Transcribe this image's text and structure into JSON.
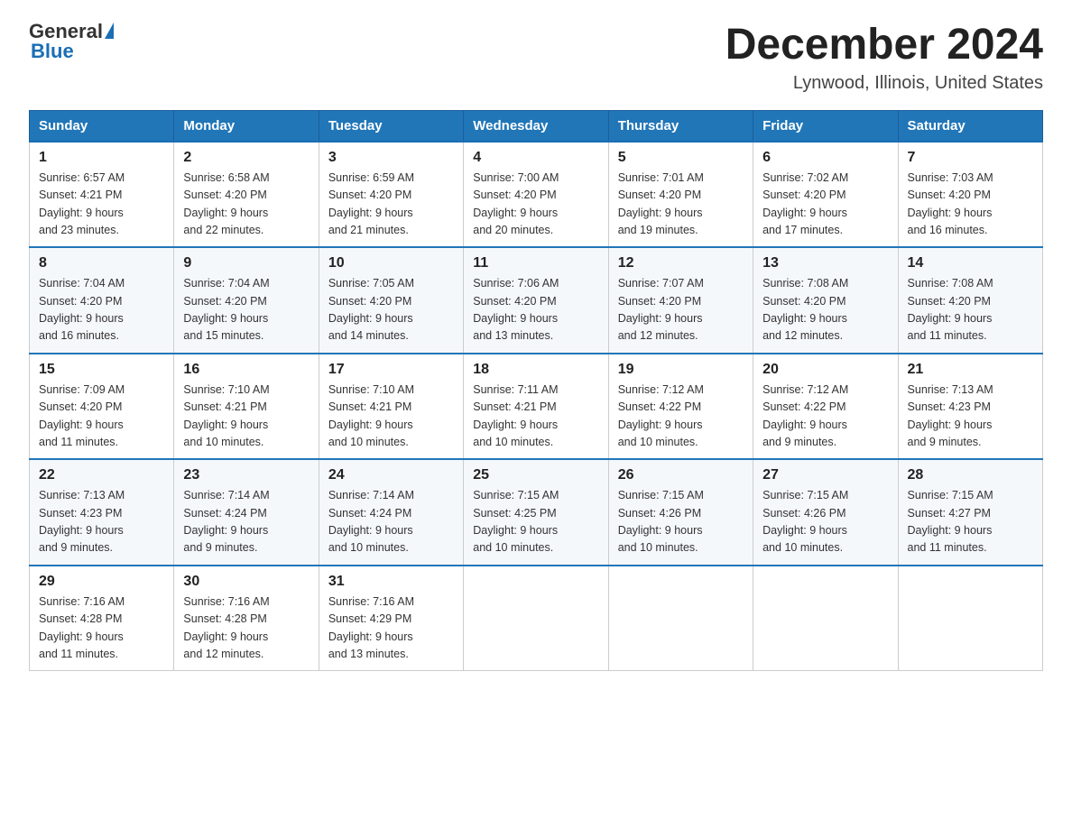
{
  "header": {
    "logo_general": "General",
    "logo_blue": "Blue",
    "month_title": "December 2024",
    "location": "Lynwood, Illinois, United States"
  },
  "days_of_week": [
    "Sunday",
    "Monday",
    "Tuesday",
    "Wednesday",
    "Thursday",
    "Friday",
    "Saturday"
  ],
  "weeks": [
    [
      {
        "day": "1",
        "sunrise": "6:57 AM",
        "sunset": "4:21 PM",
        "daylight": "9 hours and 23 minutes."
      },
      {
        "day": "2",
        "sunrise": "6:58 AM",
        "sunset": "4:20 PM",
        "daylight": "9 hours and 22 minutes."
      },
      {
        "day": "3",
        "sunrise": "6:59 AM",
        "sunset": "4:20 PM",
        "daylight": "9 hours and 21 minutes."
      },
      {
        "day": "4",
        "sunrise": "7:00 AM",
        "sunset": "4:20 PM",
        "daylight": "9 hours and 20 minutes."
      },
      {
        "day": "5",
        "sunrise": "7:01 AM",
        "sunset": "4:20 PM",
        "daylight": "9 hours and 19 minutes."
      },
      {
        "day": "6",
        "sunrise": "7:02 AM",
        "sunset": "4:20 PM",
        "daylight": "9 hours and 17 minutes."
      },
      {
        "day": "7",
        "sunrise": "7:03 AM",
        "sunset": "4:20 PM",
        "daylight": "9 hours and 16 minutes."
      }
    ],
    [
      {
        "day": "8",
        "sunrise": "7:04 AM",
        "sunset": "4:20 PM",
        "daylight": "9 hours and 16 minutes."
      },
      {
        "day": "9",
        "sunrise": "7:04 AM",
        "sunset": "4:20 PM",
        "daylight": "9 hours and 15 minutes."
      },
      {
        "day": "10",
        "sunrise": "7:05 AM",
        "sunset": "4:20 PM",
        "daylight": "9 hours and 14 minutes."
      },
      {
        "day": "11",
        "sunrise": "7:06 AM",
        "sunset": "4:20 PM",
        "daylight": "9 hours and 13 minutes."
      },
      {
        "day": "12",
        "sunrise": "7:07 AM",
        "sunset": "4:20 PM",
        "daylight": "9 hours and 12 minutes."
      },
      {
        "day": "13",
        "sunrise": "7:08 AM",
        "sunset": "4:20 PM",
        "daylight": "9 hours and 12 minutes."
      },
      {
        "day": "14",
        "sunrise": "7:08 AM",
        "sunset": "4:20 PM",
        "daylight": "9 hours and 11 minutes."
      }
    ],
    [
      {
        "day": "15",
        "sunrise": "7:09 AM",
        "sunset": "4:20 PM",
        "daylight": "9 hours and 11 minutes."
      },
      {
        "day": "16",
        "sunrise": "7:10 AM",
        "sunset": "4:21 PM",
        "daylight": "9 hours and 10 minutes."
      },
      {
        "day": "17",
        "sunrise": "7:10 AM",
        "sunset": "4:21 PM",
        "daylight": "9 hours and 10 minutes."
      },
      {
        "day": "18",
        "sunrise": "7:11 AM",
        "sunset": "4:21 PM",
        "daylight": "9 hours and 10 minutes."
      },
      {
        "day": "19",
        "sunrise": "7:12 AM",
        "sunset": "4:22 PM",
        "daylight": "9 hours and 10 minutes."
      },
      {
        "day": "20",
        "sunrise": "7:12 AM",
        "sunset": "4:22 PM",
        "daylight": "9 hours and 9 minutes."
      },
      {
        "day": "21",
        "sunrise": "7:13 AM",
        "sunset": "4:23 PM",
        "daylight": "9 hours and 9 minutes."
      }
    ],
    [
      {
        "day": "22",
        "sunrise": "7:13 AM",
        "sunset": "4:23 PM",
        "daylight": "9 hours and 9 minutes."
      },
      {
        "day": "23",
        "sunrise": "7:14 AM",
        "sunset": "4:24 PM",
        "daylight": "9 hours and 9 minutes."
      },
      {
        "day": "24",
        "sunrise": "7:14 AM",
        "sunset": "4:24 PM",
        "daylight": "9 hours and 10 minutes."
      },
      {
        "day": "25",
        "sunrise": "7:15 AM",
        "sunset": "4:25 PM",
        "daylight": "9 hours and 10 minutes."
      },
      {
        "day": "26",
        "sunrise": "7:15 AM",
        "sunset": "4:26 PM",
        "daylight": "9 hours and 10 minutes."
      },
      {
        "day": "27",
        "sunrise": "7:15 AM",
        "sunset": "4:26 PM",
        "daylight": "9 hours and 10 minutes."
      },
      {
        "day": "28",
        "sunrise": "7:15 AM",
        "sunset": "4:27 PM",
        "daylight": "9 hours and 11 minutes."
      }
    ],
    [
      {
        "day": "29",
        "sunrise": "7:16 AM",
        "sunset": "4:28 PM",
        "daylight": "9 hours and 11 minutes."
      },
      {
        "day": "30",
        "sunrise": "7:16 AM",
        "sunset": "4:28 PM",
        "daylight": "9 hours and 12 minutes."
      },
      {
        "day": "31",
        "sunrise": "7:16 AM",
        "sunset": "4:29 PM",
        "daylight": "9 hours and 13 minutes."
      },
      null,
      null,
      null,
      null
    ]
  ],
  "labels": {
    "sunrise": "Sunrise:",
    "sunset": "Sunset:",
    "daylight": "Daylight:"
  }
}
